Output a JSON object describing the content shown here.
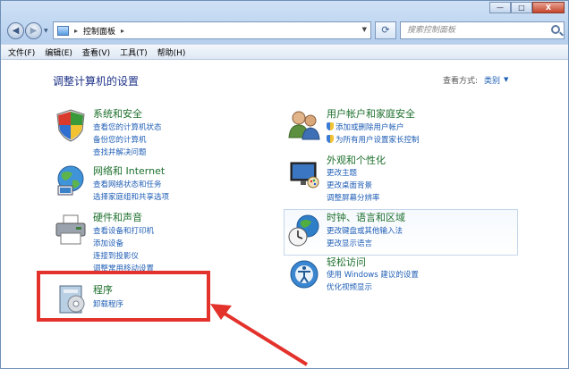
{
  "window": {
    "address_crumb": "控制面板",
    "address_separator": "▸",
    "address_arrow": "▸",
    "search_placeholder": "搜索控制面板",
    "minimize": "—",
    "maximize": "□",
    "close": "X"
  },
  "menubar": [
    "文件(F)",
    "编辑(E)",
    "查看(V)",
    "工具(T)",
    "帮助(H)"
  ],
  "page_title": "调整计算机的设置",
  "view": {
    "label": "查看方式:",
    "value": "类别"
  },
  "categories": {
    "system": {
      "title": "系统和安全",
      "links": [
        "查看您的计算机状态",
        "备份您的计算机",
        "查找并解决问题"
      ]
    },
    "network": {
      "title": "网络和 Internet",
      "links": [
        "查看网络状态和任务",
        "选择家庭组和共享选项"
      ]
    },
    "hardware": {
      "title": "硬件和声音",
      "links": [
        "查看设备和打印机",
        "添加设备",
        "连接到投影仪",
        "调整常用移动设置"
      ]
    },
    "programs": {
      "title": "程序",
      "links": [
        "卸载程序"
      ]
    },
    "users": {
      "title": "用户帐户和家庭安全",
      "links": [
        "添加或删除用户帐户",
        "为所有用户设置家长控制"
      ]
    },
    "appearance": {
      "title": "外观和个性化",
      "links": [
        "更改主题",
        "更改桌面背景",
        "调整屏幕分辨率"
      ]
    },
    "clock": {
      "title": "时钟、语言和区域",
      "links": [
        "更改键盘或其他输入法",
        "更改显示语言"
      ]
    },
    "ease": {
      "title": "轻松访问",
      "links": [
        "使用 Windows 建议的设置",
        "优化视频显示"
      ]
    }
  },
  "icons": {
    "system": "shield-icon",
    "network": "globe-network-icon",
    "hardware": "printer-icon",
    "programs": "programs-box-icon",
    "users": "users-icon",
    "appearance": "monitor-palette-icon",
    "clock": "clock-globe-icon",
    "ease": "ease-of-access-icon"
  },
  "colors": {
    "category_title": "#1d6f2c",
    "link": "#1f5eb5",
    "highlight_box": "#e3322b"
  }
}
